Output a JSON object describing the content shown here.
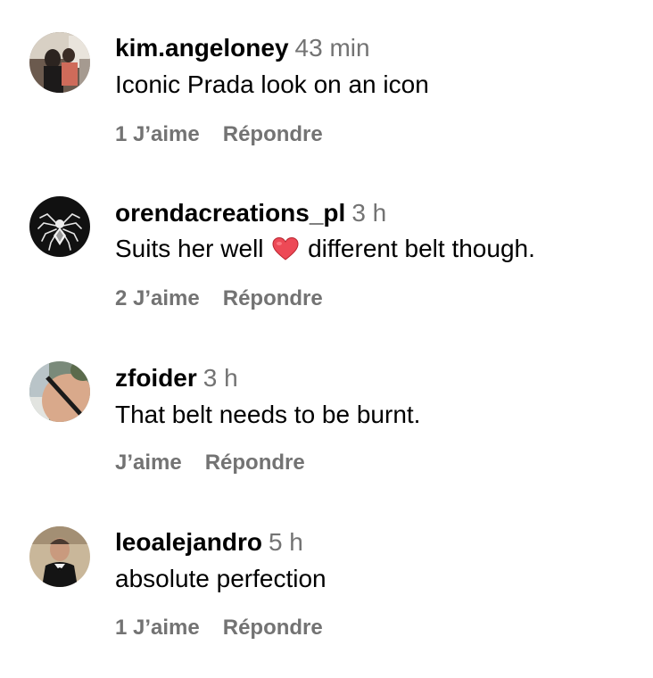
{
  "comments": [
    {
      "username": "kim.angeloney",
      "time": "43 min",
      "text": "Iconic Prada look on an icon",
      "likes": "1 J’aime",
      "reply": "Répondre"
    },
    {
      "username": "orendacreations_pl",
      "time": "3 h",
      "text_before": "Suits her well",
      "emoji": "heart-emoji",
      "text_after": "different belt though.",
      "likes": "2 J’aime",
      "reply": "Répondre"
    },
    {
      "username": "zfoider",
      "time": "3 h",
      "text": "That belt needs to be burnt.",
      "likes": "J’aime",
      "reply": "Répondre"
    },
    {
      "username": "leoalejandro",
      "time": "5 h",
      "text": "absolute perfection",
      "likes": "1 J’aime",
      "reply": "Répondre"
    }
  ],
  "colors": {
    "text": "#000000",
    "secondary": "#737373",
    "heart": "#ed4956",
    "background": "#ffffff"
  }
}
